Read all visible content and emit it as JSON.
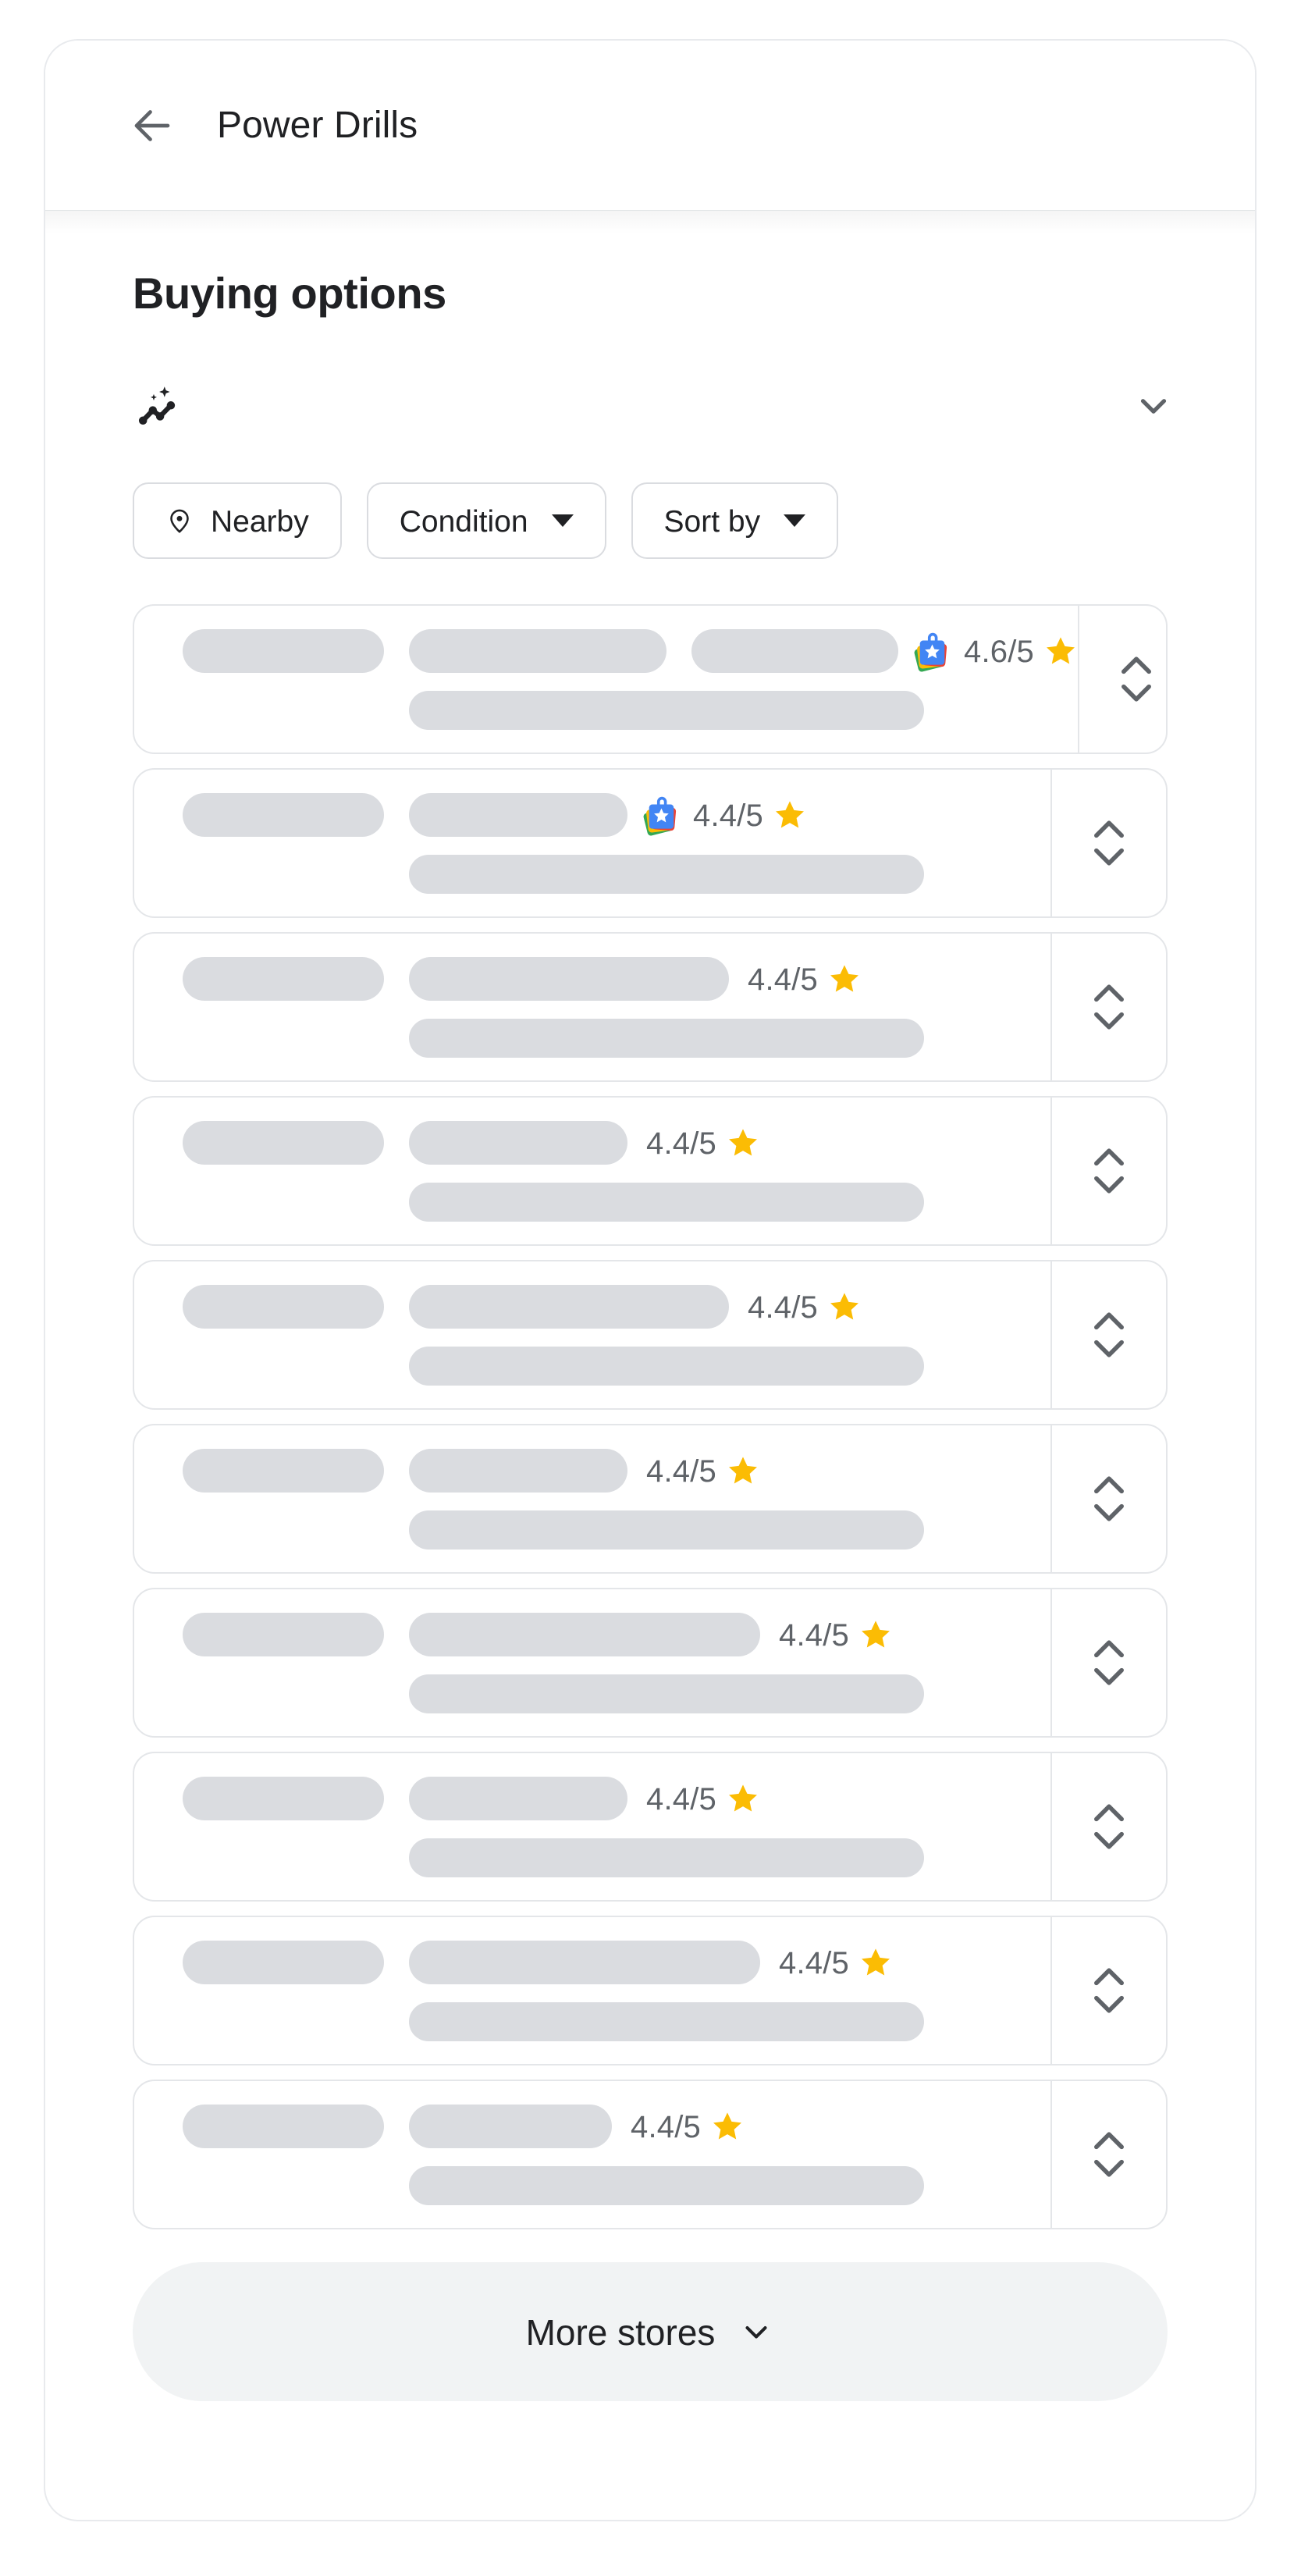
{
  "header": {
    "back_icon": "arrow-left-icon",
    "title": "Power Drills"
  },
  "main": {
    "section_title": "Buying options",
    "insights": {
      "icon": "trending-sparkle-icon",
      "expand_icon": "chevron-down-icon"
    },
    "filters": [
      {
        "label": "Nearby",
        "icon": "location-pin-icon",
        "has_caret": false
      },
      {
        "label": "Condition",
        "icon": "",
        "has_caret": true
      },
      {
        "label": "Sort by",
        "icon": "",
        "has_caret": true
      }
    ],
    "stores": [
      {
        "rating": "4.6/5",
        "badge": "google-trusted-store-badge",
        "star": "star-icon",
        "sk_mid": [
          330,
          265
        ],
        "sk_bottom": 660
      },
      {
        "rating": "4.4/5",
        "badge": "google-trusted-store-badge",
        "star": "star-icon",
        "sk_mid": [
          280
        ],
        "sk_bottom": 660
      },
      {
        "rating": "4.4/5",
        "badge": "",
        "star": "star-icon",
        "sk_mid": [
          410
        ],
        "sk_bottom": 660
      },
      {
        "rating": "4.4/5",
        "badge": "",
        "star": "star-icon",
        "sk_mid": [
          280
        ],
        "sk_bottom": 660
      },
      {
        "rating": "4.4/5",
        "badge": "",
        "star": "star-icon",
        "sk_mid": [
          410
        ],
        "sk_bottom": 660
      },
      {
        "rating": "4.4/5",
        "badge": "",
        "star": "star-icon",
        "sk_mid": [
          280
        ],
        "sk_bottom": 660
      },
      {
        "rating": "4.4/5",
        "badge": "",
        "star": "star-icon",
        "sk_mid": [
          450
        ],
        "sk_bottom": 660
      },
      {
        "rating": "4.4/5",
        "badge": "",
        "star": "star-icon",
        "sk_mid": [
          280
        ],
        "sk_bottom": 660
      },
      {
        "rating": "4.4/5",
        "badge": "",
        "star": "star-icon",
        "sk_mid": [
          450
        ],
        "sk_bottom": 660
      },
      {
        "rating": "4.4/5",
        "badge": "",
        "star": "star-icon",
        "sk_mid": [
          260
        ],
        "sk_bottom": 660
      }
    ],
    "row_expand_icon": "unfold-more-icon",
    "more_stores": {
      "label": "More stores",
      "icon": "chevron-down-icon"
    }
  },
  "colors": {
    "text_primary": "#202124",
    "text_secondary": "#5f6368",
    "skeleton": "#dadce0",
    "border": "#e4e6e9",
    "star_yellow": "#fbbc04",
    "google_blue": "#4285f4",
    "google_green": "#34a853",
    "google_yellow": "#fbbc04",
    "google_red": "#ea4335",
    "chip_surface": "#f1f3f4"
  }
}
